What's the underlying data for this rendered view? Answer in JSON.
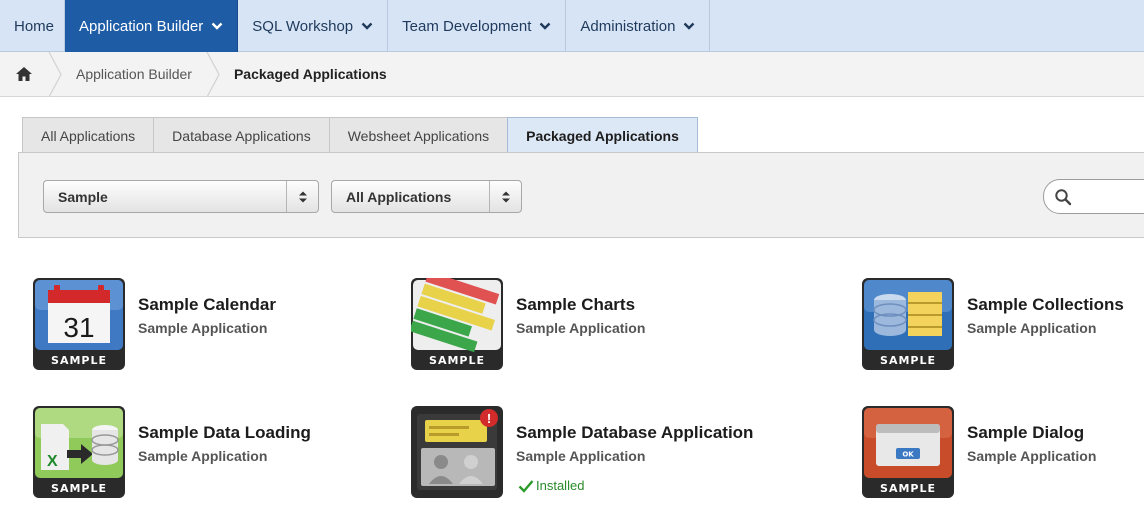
{
  "topnav": {
    "items": [
      {
        "label": "Home",
        "has_menu": false,
        "active": false
      },
      {
        "label": "Application Builder",
        "has_menu": true,
        "active": true
      },
      {
        "label": "SQL Workshop",
        "has_menu": true,
        "active": false
      },
      {
        "label": "Team Development",
        "has_menu": true,
        "active": false
      },
      {
        "label": "Administration",
        "has_menu": true,
        "active": false
      }
    ]
  },
  "breadcrumb": {
    "home_icon": "home-icon",
    "items": [
      "Application Builder",
      "Packaged Applications"
    ]
  },
  "tabs": [
    {
      "label": "All Applications",
      "active": false
    },
    {
      "label": "Database Applications",
      "active": false
    },
    {
      "label": "Websheet Applications",
      "active": false
    },
    {
      "label": "Packaged Applications",
      "active": true
    }
  ],
  "filters": {
    "category_select": "Sample",
    "type_select": "All Applications",
    "search_icon": "search-icon"
  },
  "apps": [
    {
      "title": "Sample Calendar",
      "subtitle": "Sample Application",
      "icon": "calendar-icon",
      "badge": "SAMPLE",
      "calendar_day": "31",
      "installed": ""
    },
    {
      "title": "Sample Charts",
      "subtitle": "Sample Application",
      "icon": "charts-icon",
      "badge": "SAMPLE",
      "installed": ""
    },
    {
      "title": "Sample Collections",
      "subtitle": "Sample Application",
      "icon": "collections-icon",
      "badge": "SAMPLE",
      "installed": ""
    },
    {
      "title": "Sample Data Loading",
      "subtitle": "Sample Application",
      "icon": "data-loading-icon",
      "badge": "SAMPLE",
      "installed": ""
    },
    {
      "title": "Sample Database Application",
      "subtitle": "Sample Application",
      "icon": "database-application-icon",
      "badge": "",
      "installed": "Installed"
    },
    {
      "title": "Sample Dialog",
      "subtitle": "Sample Application",
      "icon": "dialog-icon",
      "badge": "SAMPLE",
      "dialog_button": "OK",
      "installed": ""
    }
  ],
  "colors": {
    "nav_bg": "#d7e4f5",
    "nav_active": "#1f5ca6",
    "installed_green": "#2a8a2a"
  }
}
